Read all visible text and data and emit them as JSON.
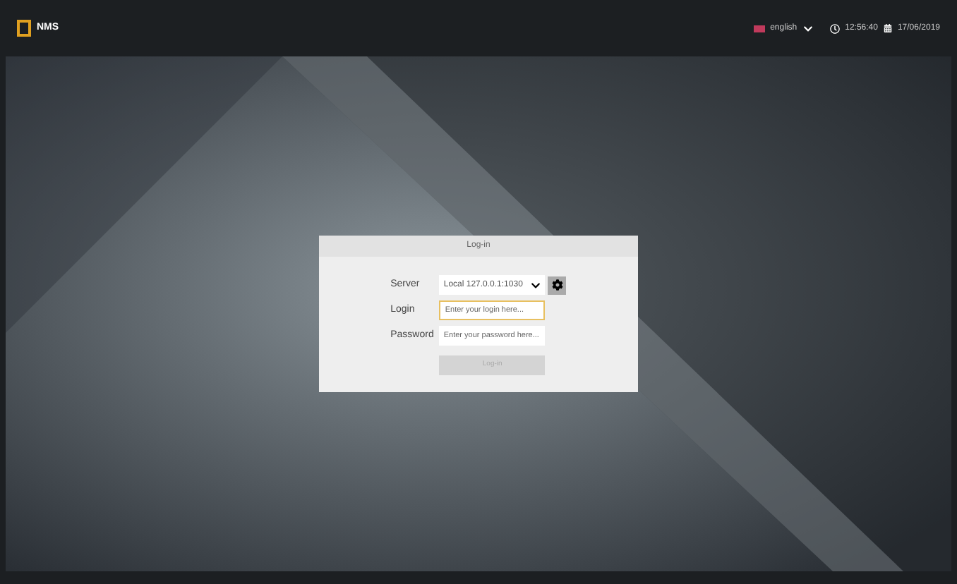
{
  "header": {
    "logo_text": "NMS",
    "language": "english",
    "time": "12:56:40",
    "date": "17/06/2019"
  },
  "dialog": {
    "title": "Log-in",
    "server": {
      "label": "Server",
      "value": "Local 127.0.0.1:1030"
    },
    "login": {
      "label": "Login",
      "placeholder": "Enter your login here...",
      "focused": true
    },
    "password": {
      "label": "Password",
      "placeholder": "Enter your password here..."
    },
    "submit": {
      "label": "Log-in",
      "disabled": true
    }
  }
}
